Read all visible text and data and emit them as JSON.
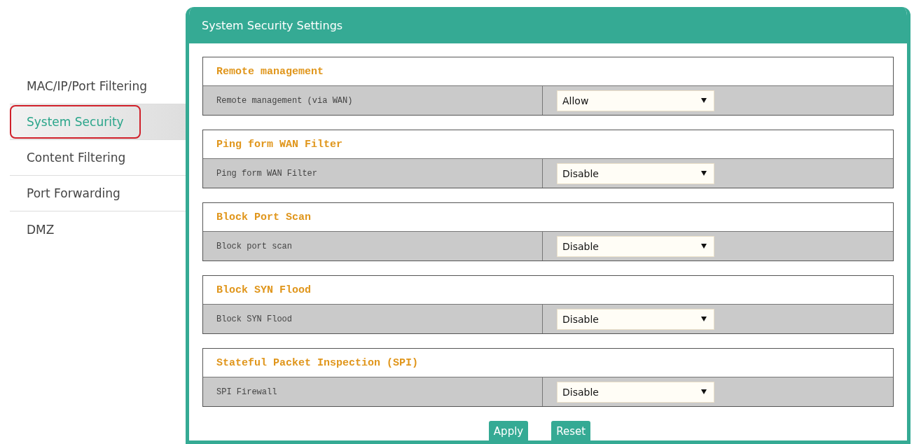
{
  "sidebar": {
    "items": [
      {
        "label": "MAC/IP/Port Filtering",
        "selected": false,
        "annotated": false
      },
      {
        "label": "System Security",
        "selected": true,
        "annotated": true
      },
      {
        "label": "Content Filtering",
        "selected": false,
        "annotated": false
      },
      {
        "label": "Port Forwarding",
        "selected": false,
        "annotated": false
      },
      {
        "label": "DMZ",
        "selected": false,
        "annotated": false
      }
    ]
  },
  "panel": {
    "title": "System Security Settings",
    "sections": [
      {
        "title": "Remote management",
        "label": "Remote management (via WAN)",
        "value": "Allow"
      },
      {
        "title": "Ping form WAN Filter",
        "label": "Ping form WAN Filter",
        "value": "Disable"
      },
      {
        "title": "Block Port Scan",
        "label": "Block port scan",
        "value": "Disable"
      },
      {
        "title": "Block SYN Flood",
        "label": "Block SYN Flood",
        "value": "Disable"
      },
      {
        "title": "Stateful Packet Inspection (SPI)",
        "label": "SPI Firewall",
        "value": "Disable"
      }
    ],
    "buttons": [
      "Apply",
      "Reset"
    ]
  }
}
